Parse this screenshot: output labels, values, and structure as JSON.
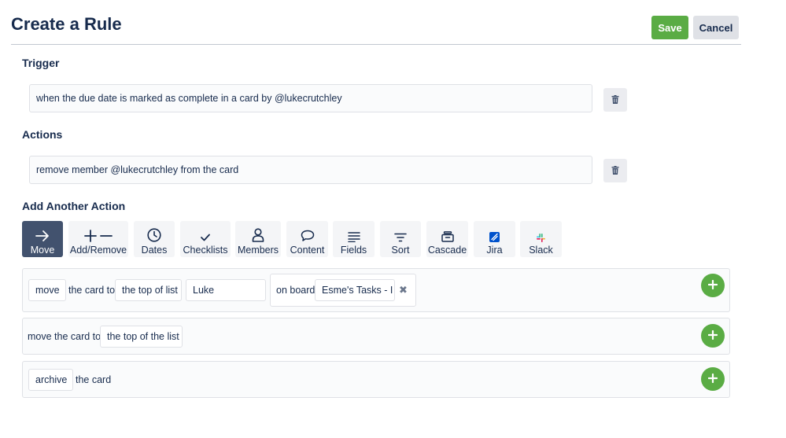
{
  "header": {
    "title": "Create a Rule",
    "save_label": "Save",
    "cancel_label": "Cancel"
  },
  "trigger": {
    "heading": "Trigger",
    "text": "when the due date is marked as complete in a card by @lukecrutchley"
  },
  "actions": {
    "heading": "Actions",
    "text": "remove member @lukecrutchley from the card"
  },
  "add_action": {
    "heading": "Add Another Action",
    "tiles": [
      {
        "label": "Move",
        "icon": "arrow-right-icon",
        "selected": true
      },
      {
        "label": "Add/Remove",
        "icon": "plus-minus-icon"
      },
      {
        "label": "Dates",
        "icon": "clock-icon"
      },
      {
        "label": "Checklists",
        "icon": "checkmark-icon"
      },
      {
        "label": "Members",
        "icon": "person-icon"
      },
      {
        "label": "Content",
        "icon": "speech-bubble-icon"
      },
      {
        "label": "Fields",
        "icon": "lines-icon"
      },
      {
        "label": "Sort",
        "icon": "filter-icon"
      },
      {
        "label": "Cascade",
        "icon": "stack-icon"
      },
      {
        "label": "Jira",
        "icon": "jira-icon"
      },
      {
        "label": "Slack",
        "icon": "slack-icon"
      }
    ]
  },
  "options": [
    {
      "verb": "move",
      "text1": "the card to",
      "position": "the top of list",
      "list_value": "Luke",
      "board_label": "on board",
      "board_value": "Esme's Tasks - I"
    },
    {
      "text1": "move the card to",
      "position": "the top of the list"
    },
    {
      "verb": "archive",
      "text1": "the card"
    }
  ],
  "colors": {
    "primary_text": "#172b4d",
    "save_green": "#5aac44",
    "selected_tile": "#42526e",
    "jira_blue": "#0052cc"
  }
}
